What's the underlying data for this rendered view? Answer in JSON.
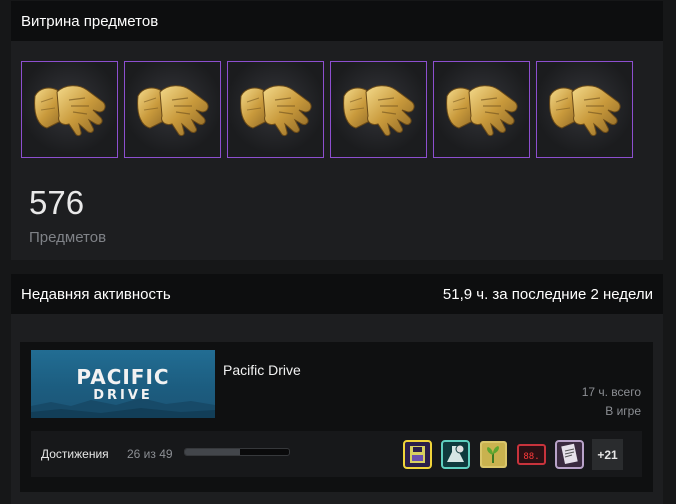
{
  "showcase": {
    "title": "Витрина предметов",
    "items": [
      {
        "name": "gloves-item",
        "rarity_color": "#8d4fcf"
      },
      {
        "name": "gloves-item",
        "rarity_color": "#8d4fcf"
      },
      {
        "name": "gloves-item",
        "rarity_color": "#8d4fcf"
      },
      {
        "name": "gloves-item",
        "rarity_color": "#8d4fcf"
      },
      {
        "name": "gloves-item",
        "rarity_color": "#8d4fcf"
      },
      {
        "name": "gloves-item",
        "rarity_color": "#8d4fcf"
      }
    ],
    "item_count": "576",
    "item_count_label": "Предметов"
  },
  "activity": {
    "title": "Недавняя активность",
    "summary": "51,9 ч. за последние 2 недели",
    "game": {
      "name": "Pacific Drive",
      "logo_main": "PACIFIC",
      "logo_sub": "DRIVE",
      "hours_total": "17 ч. всего",
      "status": "В игре",
      "achievements": {
        "label": "Достижения",
        "count": "26 из 49",
        "progress": 0.53,
        "icons": [
          "floppy-disk-icon",
          "flask-icon",
          "plant-icon",
          "digital-display-icon",
          "clipboard-icon"
        ],
        "more": "+21"
      }
    }
  },
  "colors": {
    "rarity": "#8d4fcf",
    "header_bg": "#0d0e0f",
    "panel_bg": "#1d1e20"
  }
}
